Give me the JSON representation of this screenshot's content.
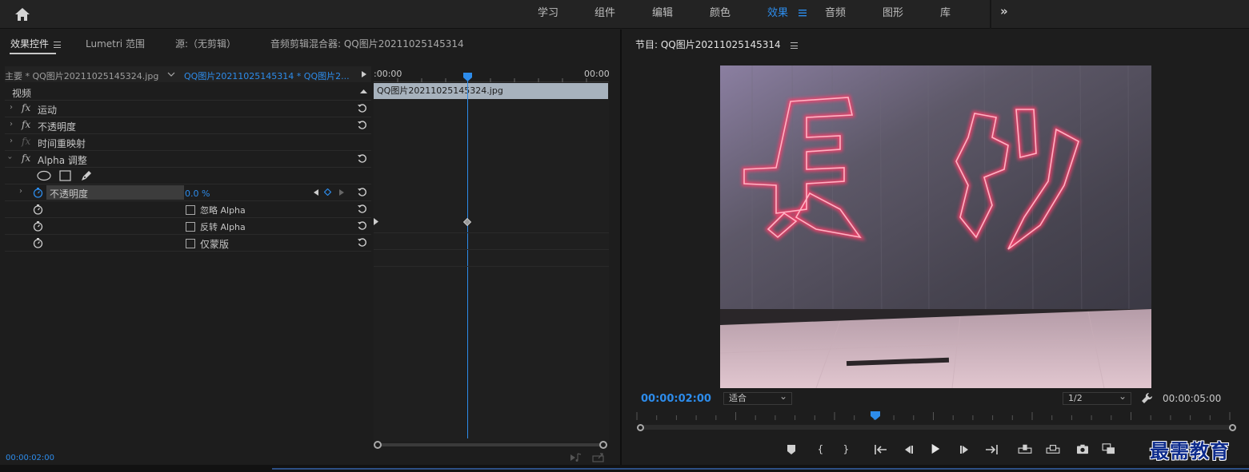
{
  "topbar": {
    "workspaces": [
      {
        "label": "学习",
        "active": false
      },
      {
        "label": "组件",
        "active": false
      },
      {
        "label": "编辑",
        "active": false
      },
      {
        "label": "颜色",
        "active": false
      },
      {
        "label": "效果",
        "active": true
      },
      {
        "label": "音频",
        "active": false
      },
      {
        "label": "图形",
        "active": false
      },
      {
        "label": "库",
        "active": false
      }
    ],
    "more_label": "»"
  },
  "left_panel": {
    "tabs": [
      {
        "label": "效果控件"
      },
      {
        "label": "Lumetri 范围"
      },
      {
        "label": "源:（无剪辑）"
      },
      {
        "label": "音频剪辑混合器: QQ图片20211025145314"
      }
    ],
    "master_label": "主要 * QQ图片20211025145324.jpg",
    "clip_label": "QQ图片20211025145314 * QQ图片2...",
    "rows": [
      {
        "label": "视频",
        "type": "section"
      },
      {
        "label": "运动",
        "type": "effect",
        "fx_dim": false
      },
      {
        "label": "不透明度",
        "type": "effect",
        "fx_dim": false
      },
      {
        "label": "时间重映射",
        "type": "effect",
        "fx_dim": true
      },
      {
        "label": "Alpha 调整",
        "type": "effect",
        "fx_dim": false
      }
    ],
    "opacity_param": {
      "label": "不透明度",
      "value": "0.0 %"
    },
    "checkboxes": [
      {
        "label": "忽略 Alpha"
      },
      {
        "label": "反转 Alpha"
      },
      {
        "label": "仅蒙版"
      }
    ],
    "timeline": {
      "start_time": ":00:00",
      "end_time": "00:00",
      "clip_name": "QQ图片20211025145324.jpg"
    },
    "current_time": "00:00:02:00"
  },
  "right_panel": {
    "title": "节目: QQ图片20211025145314",
    "timecode": "00:00:02:00",
    "zoom": "适合",
    "resolution": "1/2",
    "duration": "00:00:05:00",
    "scrub_position": 0.4
  },
  "watermark": "最需教育",
  "colors": {
    "accent": "#2d8ceb",
    "clip": "#a7b2bd"
  }
}
